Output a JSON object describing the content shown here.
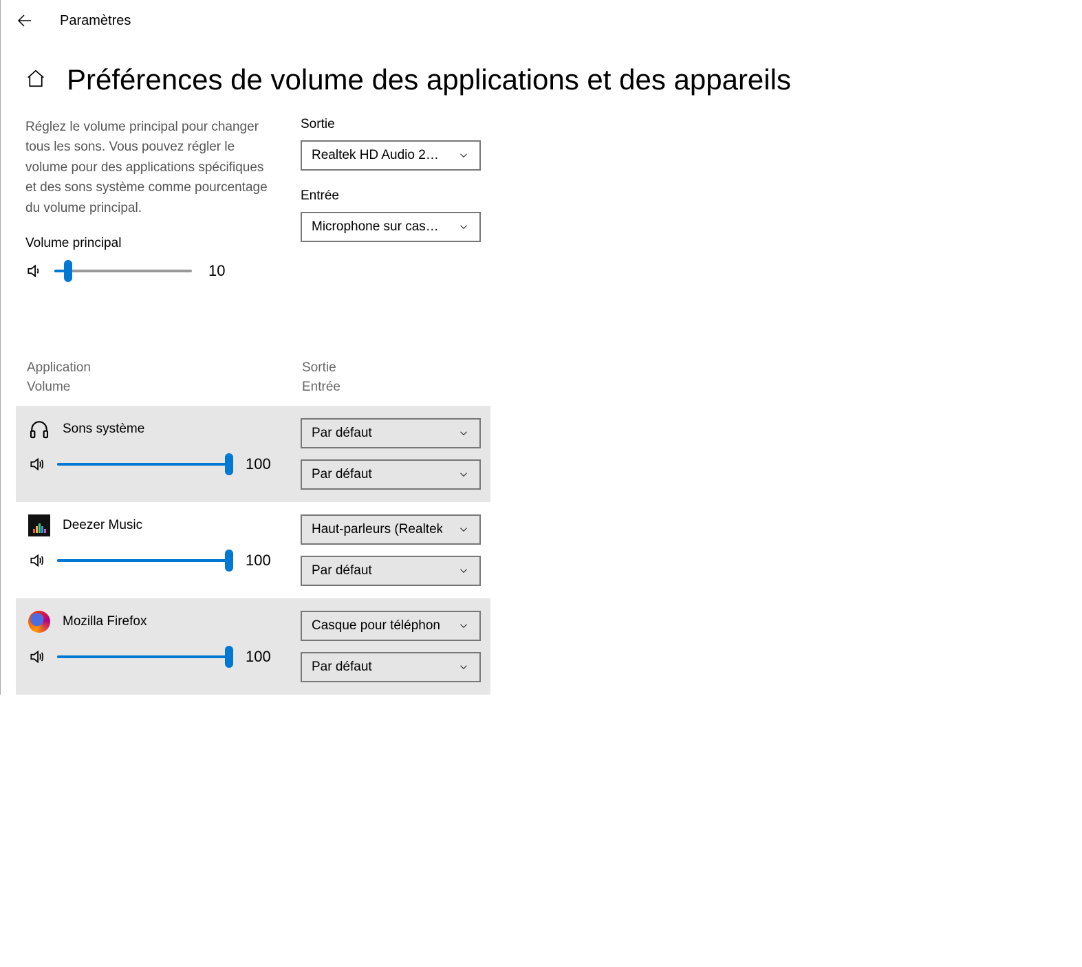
{
  "topbar": {
    "title": "Paramètres"
  },
  "header": {
    "title": "Préférences de volume des applications et des appareils"
  },
  "description": "Réglez le volume principal pour changer tous les sons. Vous pouvez régler le volume pour des applications spécifiques et des sons système comme pourcentage du volume principal.",
  "master": {
    "label": "Volume principal",
    "value": 10
  },
  "devices": {
    "output_label": "Sortie",
    "output_value": "Realtek HD Audio 2…",
    "input_label": "Entrée",
    "input_value": "Microphone sur cas…"
  },
  "apps_header": {
    "col1_line1": "Application",
    "col1_line2": "Volume",
    "col2_line1": "Sortie",
    "col2_line2": "Entrée"
  },
  "apps": [
    {
      "name": "Sons système",
      "volume": 100,
      "output": "Par défaut",
      "input": "Par défaut",
      "icon": "headphones",
      "shaded": true
    },
    {
      "name": "Deezer Music",
      "volume": 100,
      "output": "Haut-parleurs (Realtek",
      "input": "Par défaut",
      "icon": "deezer",
      "shaded": false
    },
    {
      "name": "Mozilla Firefox",
      "volume": 100,
      "output": "Casque pour téléphon",
      "input": "Par défaut",
      "icon": "firefox",
      "shaded": true
    }
  ]
}
